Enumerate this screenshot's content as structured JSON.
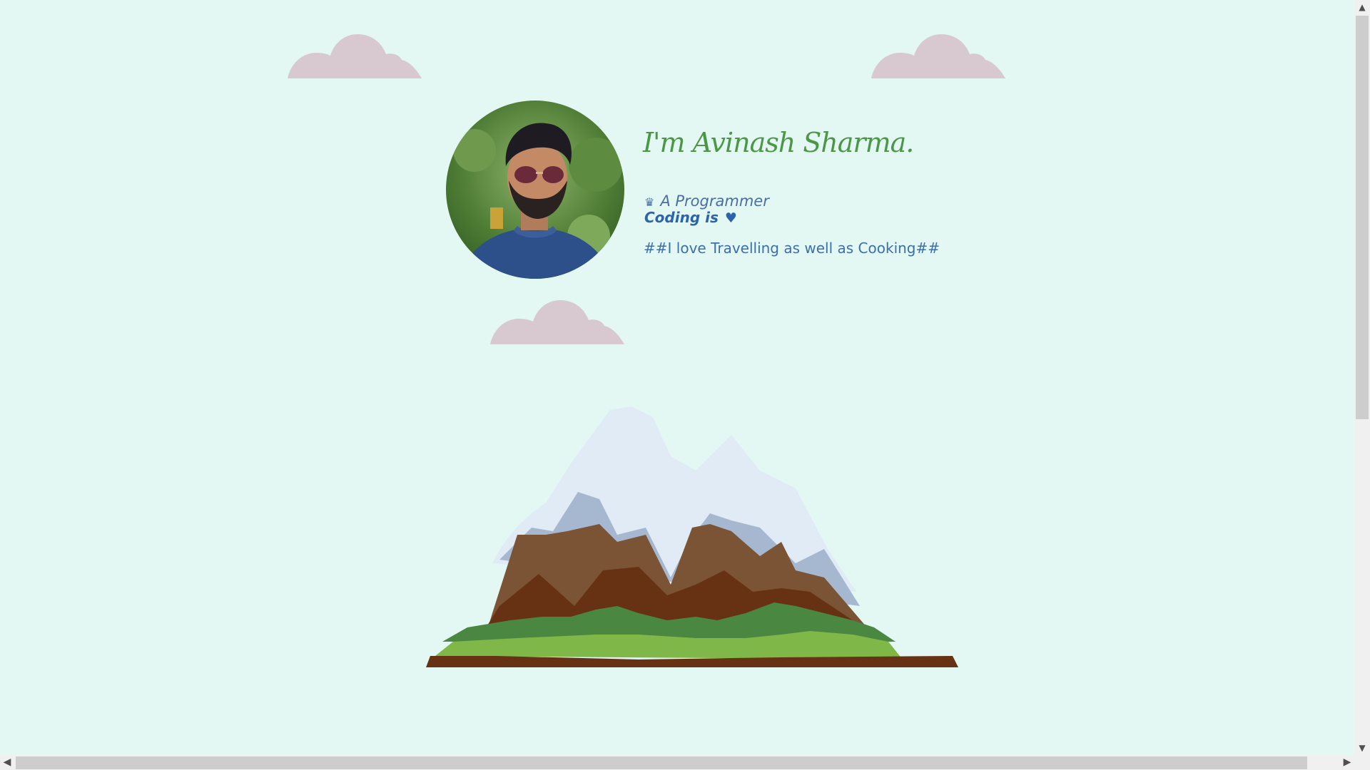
{
  "profile": {
    "greeting": "I'm Avinash Sharma.",
    "role_icon": "robot-icon",
    "role": "A Programmer",
    "coding_text": "Coding is",
    "heart_icon": "heart-icon",
    "hobby": "##I love Travelling as well as Cooking##"
  },
  "decorations": {
    "cloud_icon": "cloud-icon",
    "mountain_icon": "mountain-illustration"
  },
  "colors": {
    "background": "#e3f7f3",
    "greeting": "#4b9747",
    "role": "#4a6fa2",
    "coding": "#2c64ab",
    "hobby": "#3b6fae",
    "cloud": "#d8c9d0"
  }
}
